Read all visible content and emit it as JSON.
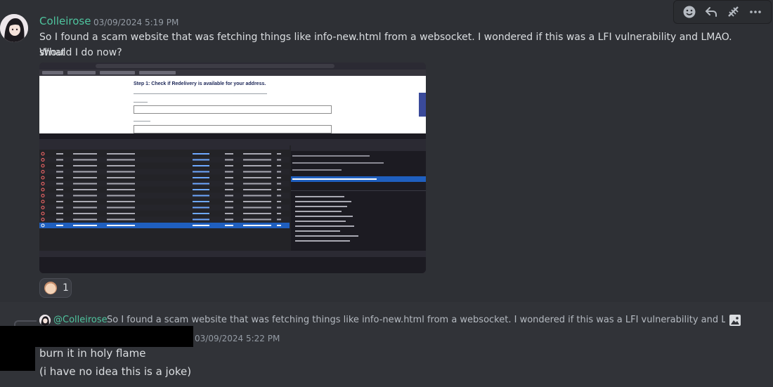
{
  "message1": {
    "username": "Colleirose",
    "timestamp": "03/09/2024 5:19 PM",
    "line1": "So I found a scam website that was fetching things like info-new.html from a websocket. I wondered if this was a LFI vulnerability and LMAO. What",
    "line2": "should I do now?",
    "attachment": {
      "page_heading": "Step 1: Check if Redelivery is available for your address."
    },
    "reaction": {
      "count": "1"
    }
  },
  "toolbar": {
    "icons": [
      "add-reaction-icon",
      "reply-icon",
      "forward-icon",
      "more-icon"
    ]
  },
  "message2": {
    "reply_username": "@Colleirose",
    "reply_preview": "So I found a scam website that was fetching things like info-new.html from a websocket. I wondered if this was a LFI vulnerability and LMAO. What sh",
    "timestamp": "03/09/2024 5:22 PM",
    "line1": "burn it in holy flame",
    "line2": "(i have no idea this is a joke)"
  },
  "colors": {
    "background": "#313338",
    "hover_background": "#2e3035",
    "username": "#4fc59f",
    "text": "#dbdee1",
    "muted": "#949ba4"
  }
}
